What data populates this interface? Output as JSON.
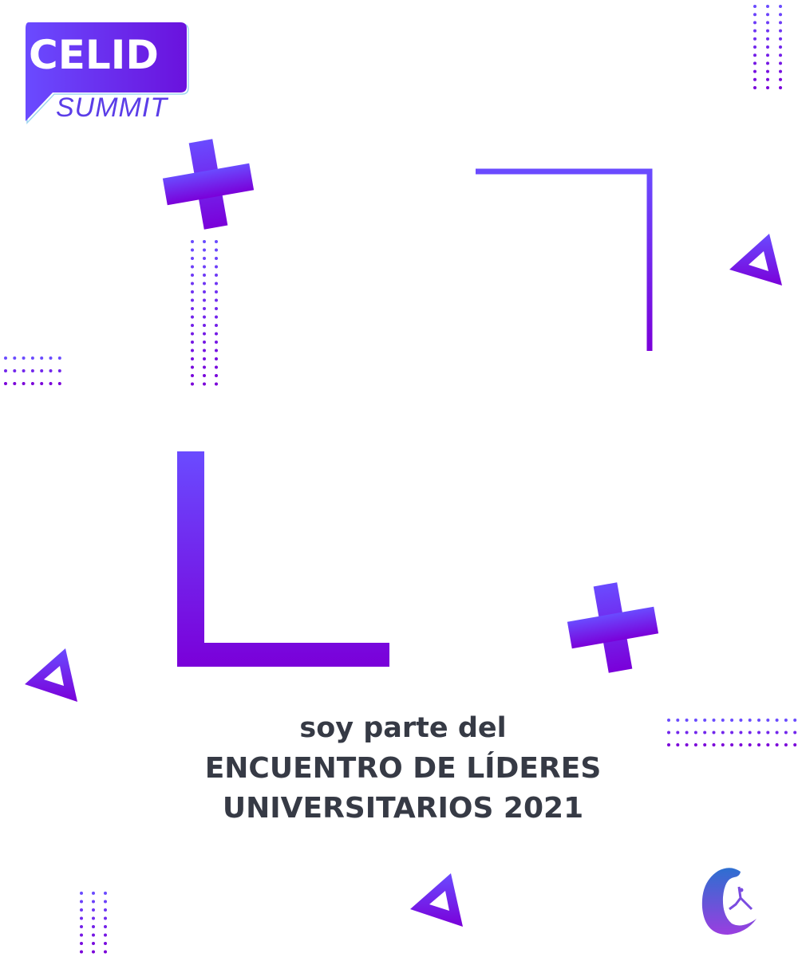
{
  "brand": {
    "logo_title": "CELID",
    "logo_subtitle": "SUMMIT"
  },
  "message": {
    "line1": "soy parte del",
    "line2": "ENCUENTRO DE LÍDERES",
    "line3": "UNIVERSITARIOS 2021"
  },
  "colors": {
    "gradient_start": "#6a4bff",
    "gradient_end": "#7a00d9",
    "text": "#363a45"
  }
}
